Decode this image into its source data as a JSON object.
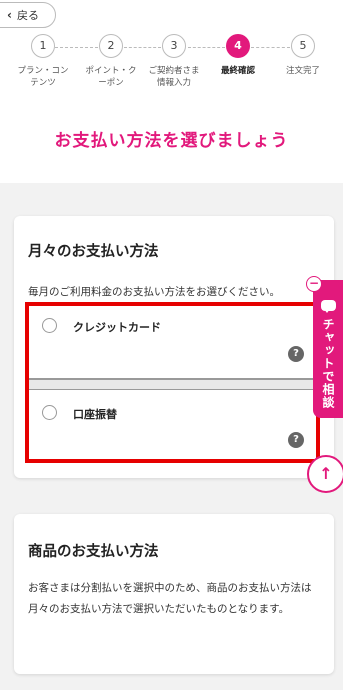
{
  "header": {
    "back_label": "戻る"
  },
  "steps": [
    {
      "number": "1",
      "label_line1": "プラン・コン",
      "label_line2": "テンツ",
      "active": false
    },
    {
      "number": "2",
      "label_line1": "ポイント・ク",
      "label_line2": "ーポン",
      "active": false
    },
    {
      "number": "3",
      "label_line1": "ご契約者さま",
      "label_line2": "情報入力",
      "active": false
    },
    {
      "number": "4",
      "label_line1": "最終確認",
      "label_line2": "",
      "active": true
    },
    {
      "number": "5",
      "label_line1": "注文完了",
      "label_line2": "",
      "active": false
    }
  ],
  "page_title": "お支払い方法を選びましょう",
  "monthly": {
    "heading": "月々のお支払い方法",
    "description": "毎月のご利用料金のお支払い方法をお選びください。",
    "options": [
      {
        "label": "クレジットカード",
        "help": "?"
      },
      {
        "label": "口座振替",
        "help": "?"
      }
    ]
  },
  "product": {
    "heading": "商品のお支払い方法",
    "text": "お客さまは分割払いを選択中のため、商品のお支払い方法は月々のお支払い方法で選択いただいたものとなります。"
  },
  "chat": {
    "label": "チャットで相談",
    "minimize_symbol": "−"
  },
  "scroll_top_symbol": "↑",
  "colors": {
    "accent": "#e2197c",
    "highlight_border": "#e60000"
  }
}
